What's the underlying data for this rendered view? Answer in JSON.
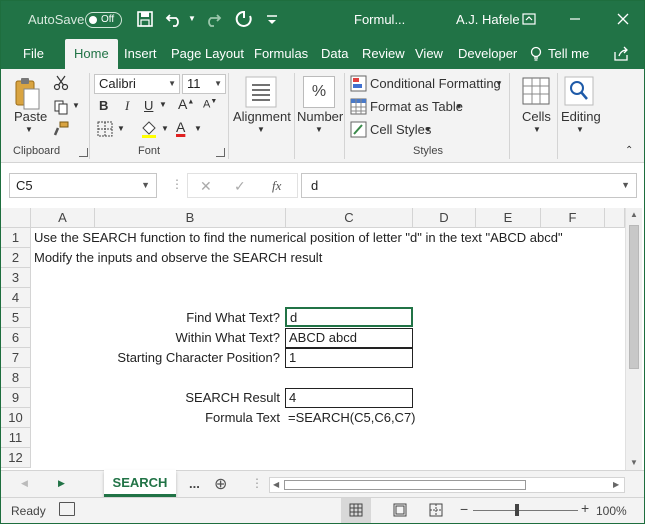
{
  "titlebar": {
    "autosave_label": "AutoSave",
    "autosave_state": "Off",
    "doc_title": "Formul...",
    "user": "A.J. Hafele"
  },
  "tabs": [
    "File",
    "Home",
    "Insert",
    "Page Layout",
    "Formulas",
    "Data",
    "Review",
    "View",
    "Developer",
    "Tell me"
  ],
  "active_tab": "Home",
  "ribbon": {
    "clipboard": {
      "paste": "Paste",
      "label": "Clipboard"
    },
    "font": {
      "name": "Calibri",
      "size": "11",
      "bold": "B",
      "italic": "I",
      "underline": "U",
      "color_letter": "A",
      "label": "Font",
      "font_color": "#e02020"
    },
    "alignment": {
      "label": "Alignment"
    },
    "number": {
      "label": "Number",
      "symbol": "%"
    },
    "styles": {
      "conditional": "Conditional Formatting",
      "format_table": "Format as Table",
      "cell_styles": "Cell Styles",
      "label": "Styles"
    },
    "cells": {
      "label": "Cells"
    },
    "editing": {
      "label": "Editing"
    }
  },
  "formula_bar": {
    "name_box": "C5",
    "cancel": "✕",
    "enter": "✓",
    "fx": "fx",
    "value": "d"
  },
  "columns": [
    "A",
    "B",
    "C",
    "D",
    "E",
    "F"
  ],
  "rows": [
    "1",
    "2",
    "3",
    "4",
    "5",
    "6",
    "7",
    "8",
    "9",
    "10",
    "11",
    "12"
  ],
  "cells": {
    "A1": "Use the SEARCH function to find the numerical position of letter \"d\" in the text \"ABCD abcd\"",
    "A2": "Modify the inputs and observe the SEARCH result",
    "B5": "Find What Text?",
    "C5": "d",
    "B6": "Within What Text?",
    "C6": "ABCD abcd",
    "B7": "Starting Character Position?",
    "C7": "1",
    "B9": "SEARCH Result",
    "C9": "4",
    "B10": "Formula Text",
    "C10": "=SEARCH(C5,C6,C7)"
  },
  "sheet_tabs": {
    "active": "SEARCH",
    "more": "...",
    "add": "⊕"
  },
  "status": {
    "ready": "Ready",
    "zoom": "100%"
  },
  "colors": {
    "accent": "#217346",
    "ribbon_bg": "#f3f3f3",
    "grid_line": "#d4d4d4"
  }
}
